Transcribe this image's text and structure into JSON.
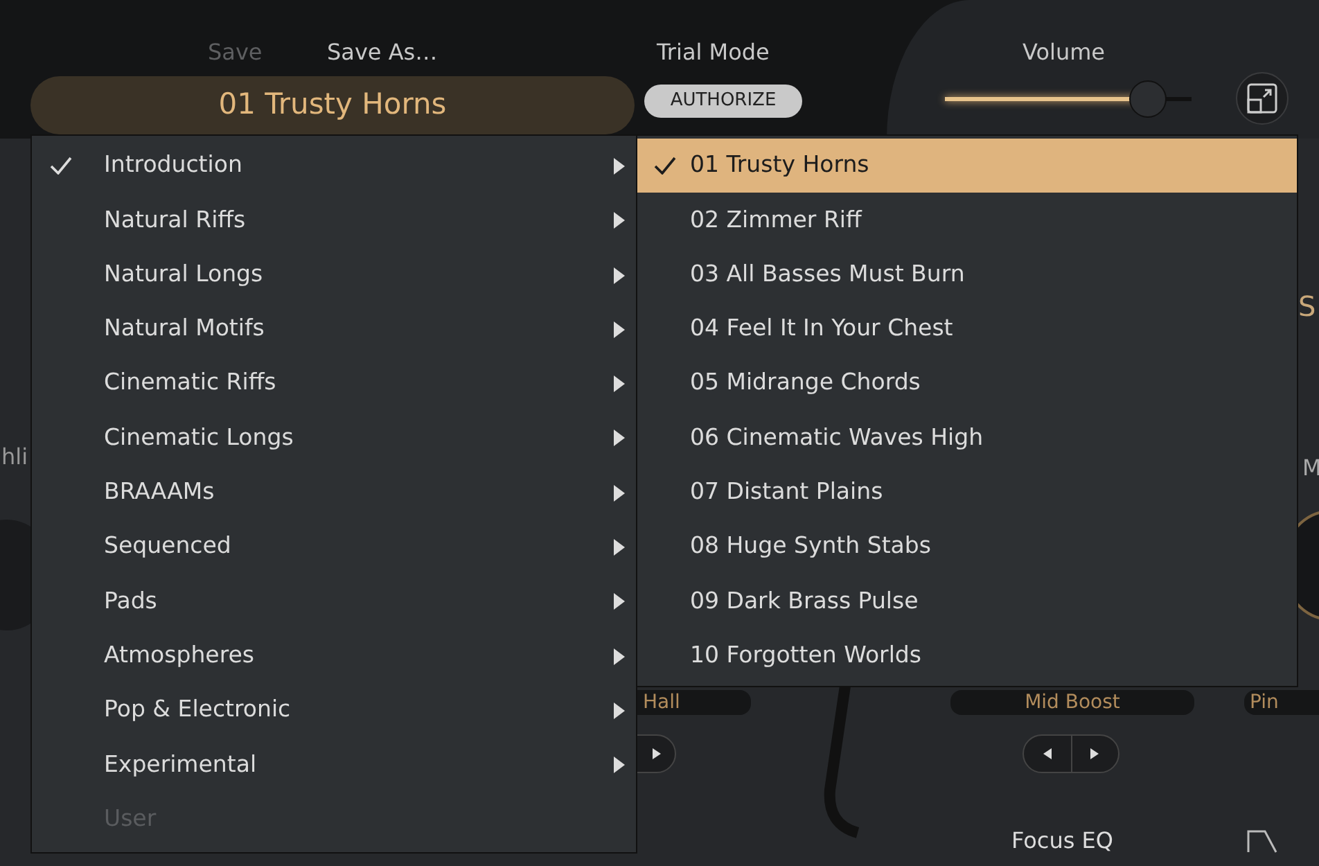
{
  "header": {
    "save": {
      "label": "Save",
      "disabled": true
    },
    "save_as": {
      "label": "Save As…",
      "disabled": false
    },
    "preset_name": "01 Trusty Horns",
    "trial_mode": "Trial Mode",
    "authorize": "AUTHORIZE",
    "volume": {
      "label": "Volume",
      "level": 0.82
    }
  },
  "background": {
    "left_label": "hli",
    "right_label_top": "S",
    "right_label_mid": "M",
    "reverb": "Hall",
    "eq_preset": "Mid Boost",
    "right_preset": "Pin",
    "focus_eq": "Focus EQ"
  },
  "categories": [
    {
      "label": "Introduction",
      "checked": true,
      "disabled": false,
      "has_submenu": true
    },
    {
      "label": "Natural Riffs",
      "checked": false,
      "disabled": false,
      "has_submenu": true
    },
    {
      "label": "Natural Longs",
      "checked": false,
      "disabled": false,
      "has_submenu": true
    },
    {
      "label": "Natural Motifs",
      "checked": false,
      "disabled": false,
      "has_submenu": true
    },
    {
      "label": "Cinematic Riffs",
      "checked": false,
      "disabled": false,
      "has_submenu": true
    },
    {
      "label": "Cinematic Longs",
      "checked": false,
      "disabled": false,
      "has_submenu": true
    },
    {
      "label": "BRAAAMs",
      "checked": false,
      "disabled": false,
      "has_submenu": true
    },
    {
      "label": "Sequenced",
      "checked": false,
      "disabled": false,
      "has_submenu": true
    },
    {
      "label": "Pads",
      "checked": false,
      "disabled": false,
      "has_submenu": true
    },
    {
      "label": "Atmospheres",
      "checked": false,
      "disabled": false,
      "has_submenu": true
    },
    {
      "label": "Pop & Electronic",
      "checked": false,
      "disabled": false,
      "has_submenu": true
    },
    {
      "label": "Experimental",
      "checked": false,
      "disabled": false,
      "has_submenu": true
    },
    {
      "label": "User",
      "checked": false,
      "disabled": true,
      "has_submenu": false
    }
  ],
  "presets": [
    {
      "label": "01 Trusty Horns",
      "selected": true
    },
    {
      "label": "02 Zimmer Riff",
      "selected": false
    },
    {
      "label": "03 All Basses Must Burn",
      "selected": false
    },
    {
      "label": "04 Feel It In Your Chest",
      "selected": false
    },
    {
      "label": "05 Midrange Chords",
      "selected": false
    },
    {
      "label": "06 Cinematic Waves High",
      "selected": false
    },
    {
      "label": "07 Distant Plains",
      "selected": false
    },
    {
      "label": "08 Huge Synth Stabs",
      "selected": false
    },
    {
      "label": "09 Dark Brass Pulse",
      "selected": false
    },
    {
      "label": "10 Forgotten Worlds",
      "selected": false
    }
  ]
}
